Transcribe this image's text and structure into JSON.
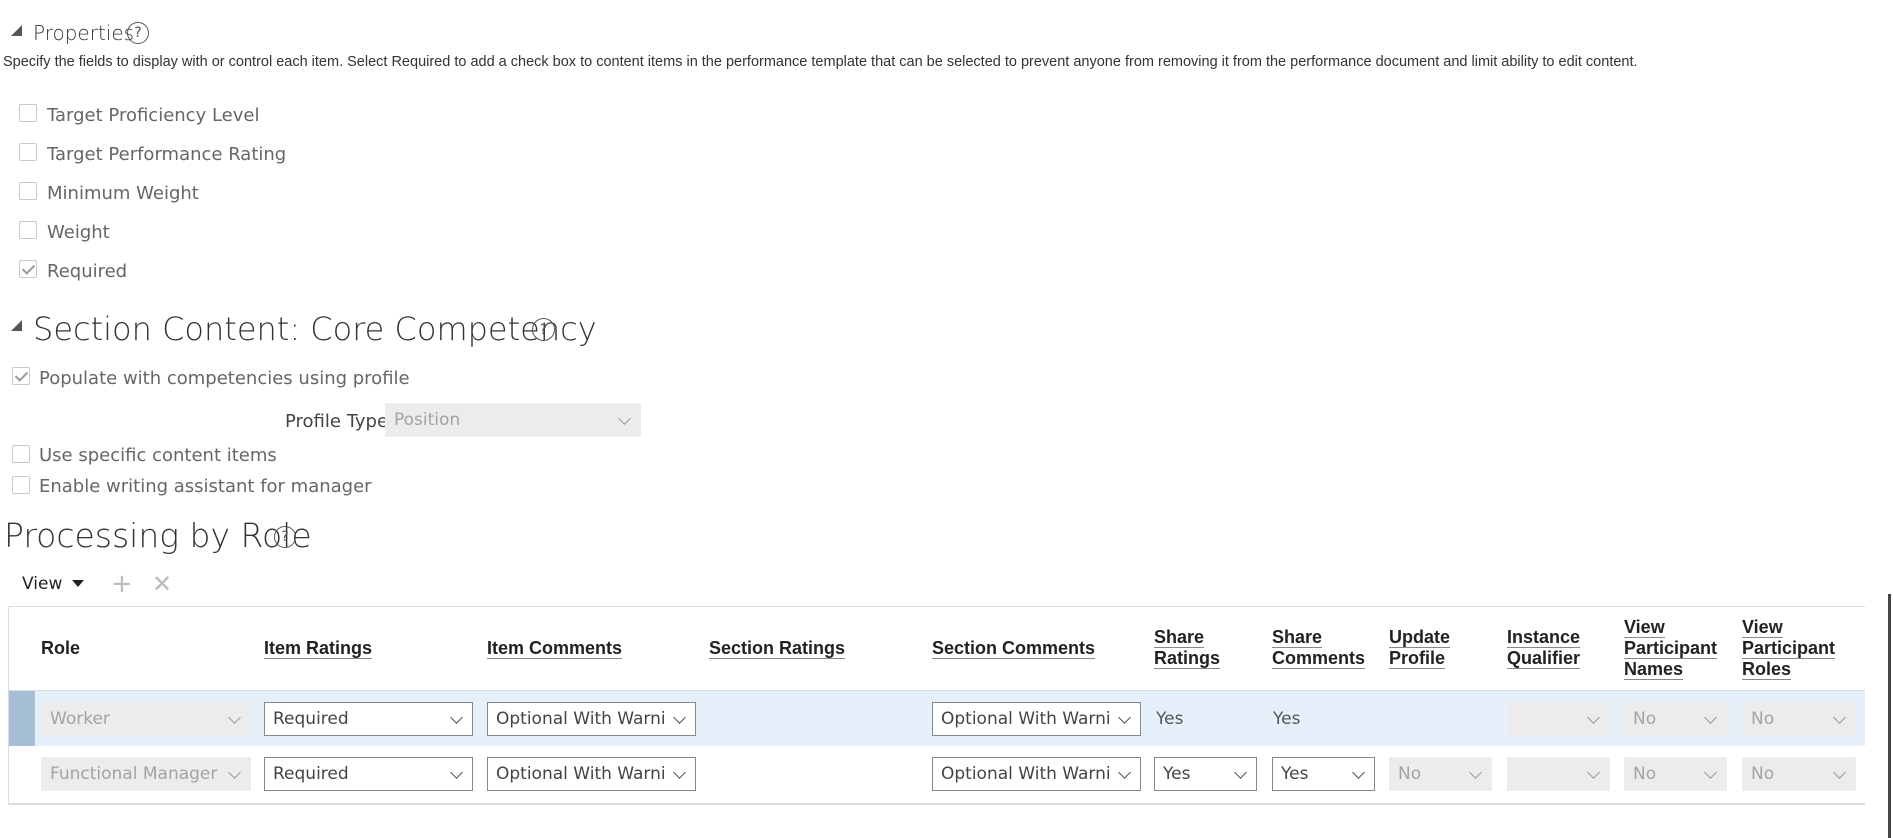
{
  "properties": {
    "title": "Properties",
    "description": "Specify the fields to display with or control each item. Select Required to add a check box to content items in the performance template that can be selected to prevent anyone from removing it from the performance document and limit ability to edit content.",
    "checkboxes": [
      {
        "label": "Target Proficiency Level",
        "checked": false
      },
      {
        "label": "Target Performance Rating",
        "checked": false
      },
      {
        "label": "Minimum Weight",
        "checked": false
      },
      {
        "label": "Weight",
        "checked": false
      },
      {
        "label": "Required",
        "checked": true
      }
    ]
  },
  "section_content": {
    "title": "Section Content: Core Competency",
    "populate_label": "Populate with competencies using profile",
    "profile_type_label": "Profile Type",
    "profile_type_value": "Position",
    "specific_items_label": "Use specific content items",
    "writing_assistant_label": "Enable writing assistant for manager"
  },
  "processing": {
    "title": "Processing by Role",
    "view_label": "View",
    "columns": [
      "Role",
      "Item Ratings",
      "Item Comments",
      "Section Ratings",
      "Section Comments",
      "Share Ratings",
      "Share Comments",
      "Update Profile",
      "Instance Qualifier",
      "View Participant Names",
      "View Participant Roles"
    ],
    "rows": [
      {
        "role": "Worker",
        "item_ratings": "Required",
        "item_comments": "Optional With Warning",
        "section_comments": "Optional With Warning",
        "share_ratings": "Yes",
        "share_comments": "Yes",
        "update_profile": "",
        "instance_qualifier": "",
        "view_participant_names": "No",
        "view_participant_roles": "No"
      },
      {
        "role": "Functional Manager",
        "item_ratings": "Required",
        "item_comments": "Optional With Warning",
        "section_comments": "Optional With Warning",
        "share_ratings": "Yes",
        "share_comments": "Yes",
        "update_profile": "No",
        "instance_qualifier": "",
        "view_participant_names": "No",
        "view_participant_roles": "No"
      }
    ]
  },
  "colors": {
    "selected_row": "#e5f0fb",
    "row_marker": "#a6bfd7",
    "disabled_field": "#ececec"
  }
}
